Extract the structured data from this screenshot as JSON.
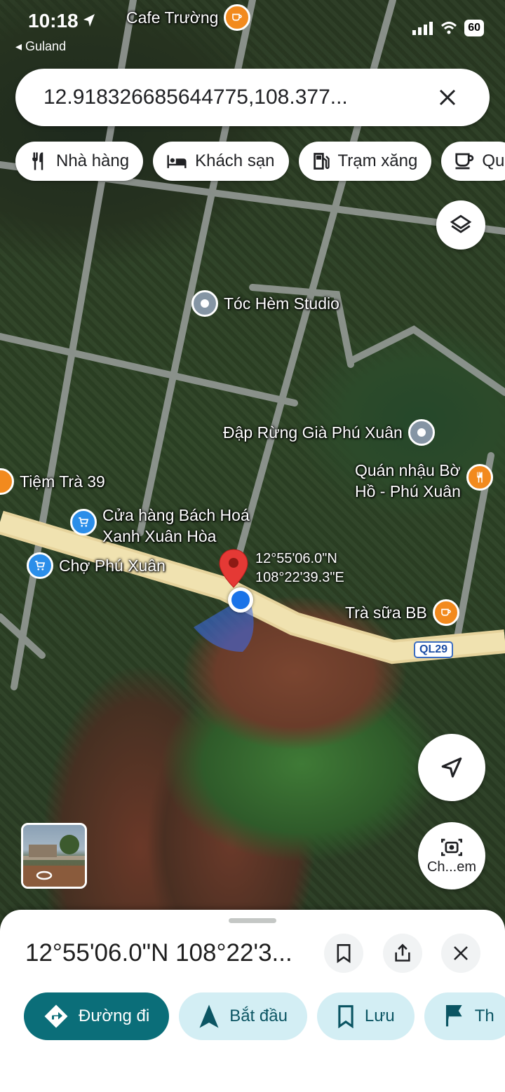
{
  "status_bar": {
    "time": "10:18",
    "back_app": "◂ Guland",
    "battery": "60"
  },
  "search": {
    "value": "12.918326685644775,108.377..."
  },
  "chips": [
    {
      "label": "Nhà hàng",
      "icon": "restaurant-icon"
    },
    {
      "label": "Khách sạn",
      "icon": "hotel-icon"
    },
    {
      "label": "Trạm xăng",
      "icon": "gas-station-icon"
    },
    {
      "label": "Qu",
      "icon": "cafe-icon"
    }
  ],
  "map": {
    "pois": [
      {
        "name": "Cafe Trường",
        "type": "cafe"
      },
      {
        "name": "Tóc Hèm Studio",
        "type": "generic"
      },
      {
        "name": "Đập Rừng Già Phú Xuân",
        "type": "generic"
      },
      {
        "name": "Quán nhậu Bờ Hồ - Phú Xuân",
        "type": "restaurant",
        "line1": "Quán nhậu Bờ",
        "line2": "Hồ - Phú Xuân"
      },
      {
        "name": "Tiệm Trà 39",
        "type": "cafe"
      },
      {
        "name": "Cửa hàng Bách Hoá Xanh Xuân Hòa",
        "type": "shopping",
        "line1": "Cửa hàng Bách Hoá",
        "line2": "Xanh Xuân Hòa"
      },
      {
        "name": "Chợ Phú Xuân",
        "type": "shopping"
      },
      {
        "name": "Trà sữa BB",
        "type": "cafe"
      }
    ],
    "pin_coords": {
      "lat": "12°55'06.0\"N",
      "lng": "108°22'39.3\"E"
    },
    "road_shield": "QL29"
  },
  "controls": {
    "lens_label": "Ch...em"
  },
  "sheet": {
    "title": "12°55'06.0\"N 108°22'3...",
    "actions": [
      {
        "label": "Đường đi",
        "icon": "directions-icon",
        "primary": true
      },
      {
        "label": "Bắt đầu",
        "icon": "navigation-arrow-icon"
      },
      {
        "label": "Lưu",
        "icon": "bookmark-icon"
      },
      {
        "label": "Th",
        "icon": "flag-icon"
      }
    ]
  },
  "colors": {
    "primary_action": "#0b6e79",
    "secondary_action": "#d3eef4",
    "marker_red": "#e53935",
    "location_blue": "#1a73e8"
  }
}
